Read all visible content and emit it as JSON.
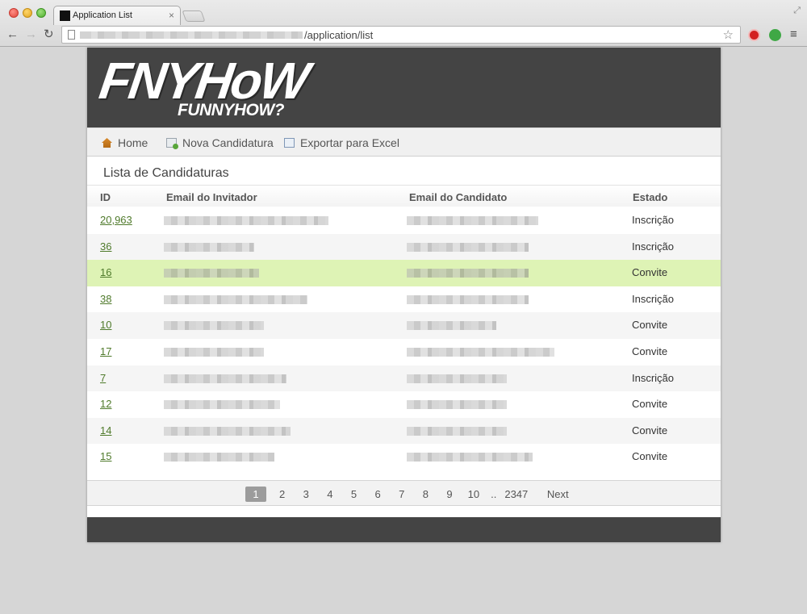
{
  "browser": {
    "tab_title": "Application List",
    "tab_close": "×",
    "url_path": "/application/list",
    "icons": [
      "back-icon",
      "forward-icon",
      "reload-icon",
      "star-icon",
      "menu-icon"
    ]
  },
  "header": {
    "logo_main": "FNYHoW",
    "logo_sub": "FUNNYHOW?"
  },
  "nav": [
    {
      "label": "Home",
      "icon": "home-icon"
    },
    {
      "label": "Nova Candidatura",
      "icon": "new-document-icon"
    },
    {
      "label": "Exportar para Excel",
      "icon": "excel-icon"
    }
  ],
  "list": {
    "title": "Lista de Candidaturas",
    "columns": [
      "ID",
      "Email do Invitador",
      "Email do Candidato",
      "Estado"
    ],
    "rows": [
      {
        "id": "20,963",
        "state": "Inscrição"
      },
      {
        "id": "36",
        "state": "Inscrição"
      },
      {
        "id": "16",
        "state": "Convite",
        "highlighted": true
      },
      {
        "id": "38",
        "state": "Inscrição"
      },
      {
        "id": "10",
        "state": "Convite"
      },
      {
        "id": "17",
        "state": "Convite"
      },
      {
        "id": "7",
        "state": "Inscrição"
      },
      {
        "id": "12",
        "state": "Convite"
      },
      {
        "id": "14",
        "state": "Convite"
      },
      {
        "id": "15",
        "state": "Convite"
      }
    ]
  },
  "pagination": {
    "pages": [
      "1",
      "2",
      "3",
      "4",
      "5",
      "6",
      "7",
      "8",
      "9",
      "10"
    ],
    "current": "1",
    "ellipsis": "..",
    "last": "2347",
    "next": "Next"
  },
  "colors": {
    "header_bg": "#444444",
    "highlight_row": "#def3b5",
    "link": "#4f7a2b"
  }
}
